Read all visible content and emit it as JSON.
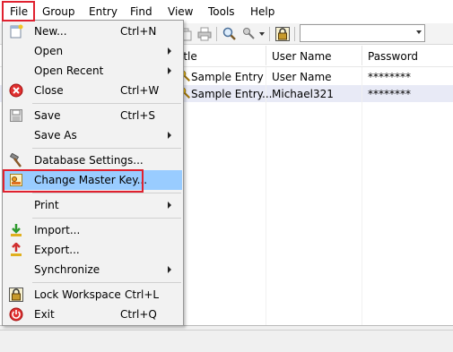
{
  "menubar": {
    "items": [
      "File",
      "Group",
      "Entry",
      "Find",
      "View",
      "Tools",
      "Help"
    ]
  },
  "toolbar": {
    "icons": [
      "copy-icon",
      "print-icon",
      "find-icon",
      "key-tool-icon",
      "lock-icon"
    ],
    "search": {
      "value": "",
      "placeholder": ""
    }
  },
  "list": {
    "columns": [
      "itle",
      "User Name",
      "Password"
    ],
    "rows": [
      {
        "title": "Sample Entry",
        "username": "User Name",
        "password": "********",
        "selected": false
      },
      {
        "title": "Sample Entry...",
        "username": "Michael321",
        "password": "********",
        "selected": true
      }
    ]
  },
  "file_menu": {
    "items": [
      {
        "label": "New...",
        "shortcut": "Ctrl+N",
        "icon": "new-database-icon"
      },
      {
        "label": "Open",
        "submenu": true
      },
      {
        "label": "Open Recent",
        "submenu": true
      },
      {
        "label": "Close",
        "shortcut": "Ctrl+W",
        "icon": "close-red-icon"
      },
      {
        "label": "Save",
        "shortcut": "Ctrl+S",
        "icon": "save-disk-icon"
      },
      {
        "label": "Save As",
        "submenu": true
      },
      {
        "label": "Database Settings...",
        "icon": "hammer-icon"
      },
      {
        "label": "Change Master Key...",
        "icon": "master-key-icon",
        "highlighted": true
      },
      {
        "label": "Print",
        "submenu": true
      },
      {
        "label": "Import...",
        "icon": "import-arrow-icon"
      },
      {
        "label": "Export...",
        "icon": "export-arrow-icon"
      },
      {
        "label": "Synchronize",
        "submenu": true
      },
      {
        "label": "Lock Workspace",
        "shortcut": "Ctrl+L",
        "icon": "lock-icon"
      },
      {
        "label": "Exit",
        "shortcut": "Ctrl+Q",
        "icon": "exit-power-icon"
      }
    ]
  },
  "colors": {
    "highlight": "#99ccff",
    "annotation_red": "#e0212f",
    "selected_row": "#e8eaf6"
  }
}
